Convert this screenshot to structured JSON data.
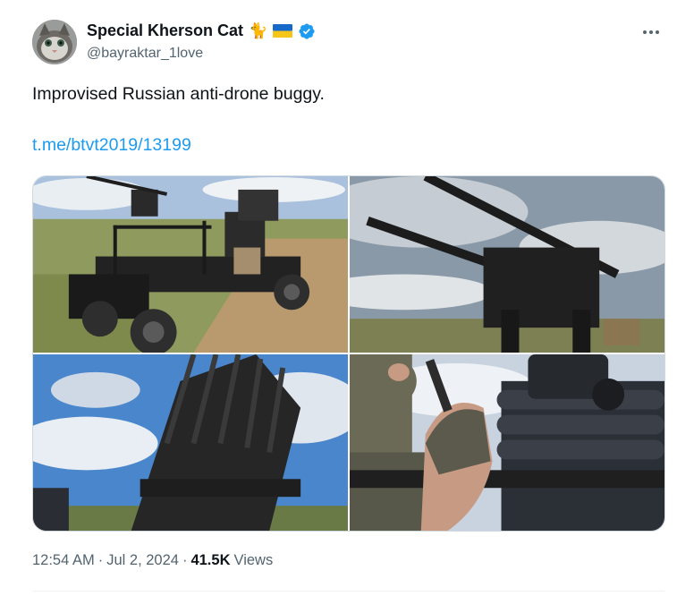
{
  "author": {
    "display_name": "Special Kherson Cat",
    "emojis": "🐈",
    "handle": "@bayraktar_1love",
    "verified": true
  },
  "tweet": {
    "text": "Improvised Russian anti-drone buggy.",
    "link": "t.me/btvt2019/13199"
  },
  "media": {
    "photos": [
      {
        "depicts": "buggy-with-machine-guns"
      },
      {
        "depicts": "twin-machine-guns-closeup"
      },
      {
        "depicts": "rocket-rack-launcher"
      },
      {
        "depicts": "gloved-hand-on-gun-barrels"
      }
    ]
  },
  "meta": {
    "time": "12:54 AM",
    "sep1": "·",
    "date": "Jul 2, 2024",
    "sep2": "·",
    "views_count": "41.5K",
    "views_label": "Views"
  },
  "colors": {
    "link": "#1d9bf0",
    "verified": "#1d9bf0",
    "secondary_text": "#536471"
  },
  "icons": {
    "more": "more-dots-icon",
    "verified": "verified-badge-icon",
    "flag": "ukraine-flag-icon"
  }
}
